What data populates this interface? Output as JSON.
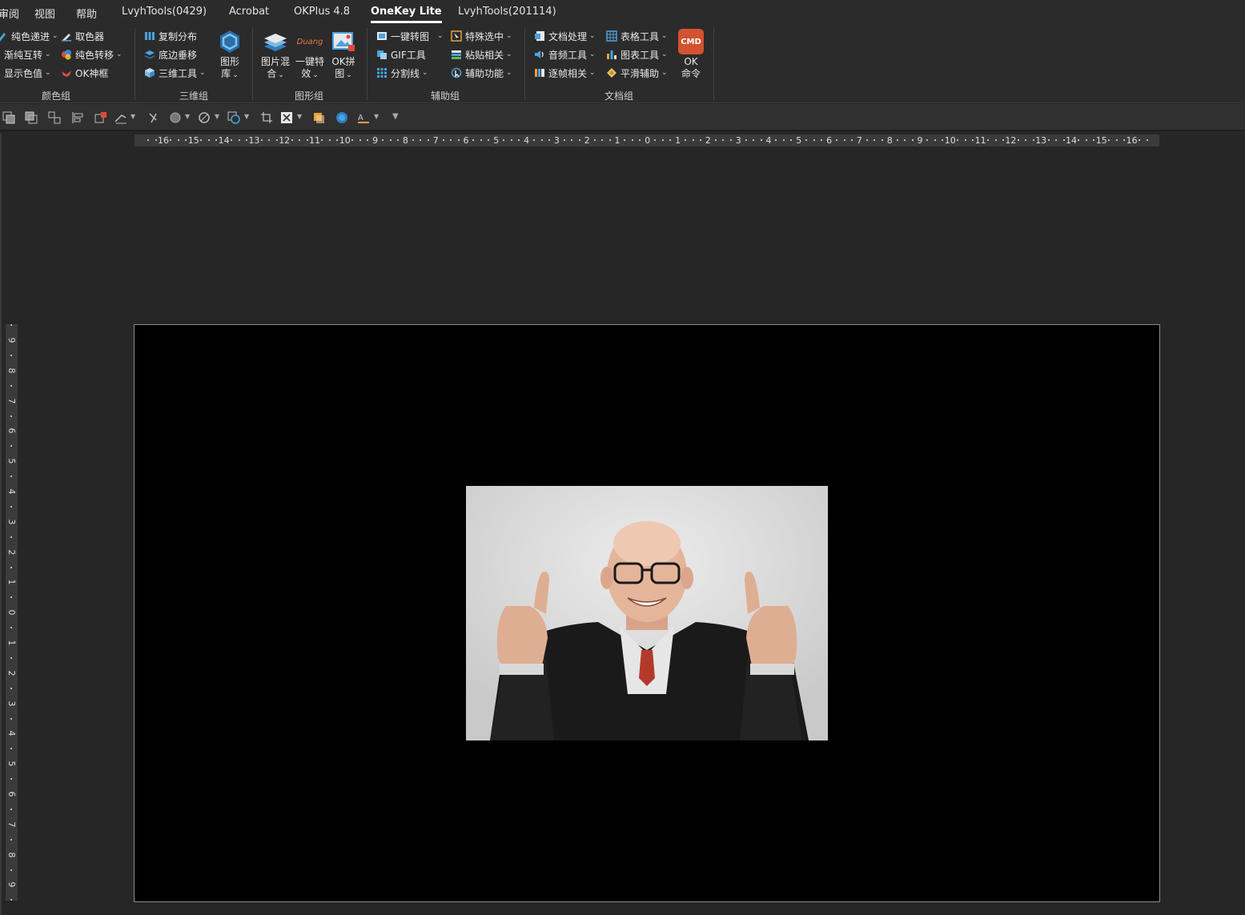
{
  "tabs": [
    "审阅",
    "视图",
    "帮助",
    "LvyhTools(0429)",
    "Acrobat",
    "OKPlus 4.8",
    "OneKey Lite",
    "LvyhTools(201114)"
  ],
  "active_tab": "OneKey Lite",
  "ribbon": {
    "color_group": {
      "label": "颜色组",
      "items": [
        "纯色递进",
        "取色器",
        "渐纯互转",
        "纯色转移",
        "显示色值",
        "OK神框"
      ]
    },
    "threed_group": {
      "label": "三维组",
      "items": [
        "复制分布",
        "底边垂移",
        "三维工具"
      ],
      "big": [
        "图形",
        "库"
      ]
    },
    "shape_group": {
      "label": "图形组",
      "big": [
        [
          "图片混",
          "合"
        ],
        [
          "一键特",
          "效"
        ],
        [
          "OK拼",
          "图"
        ]
      ],
      "duang": "Duang"
    },
    "assist_group": {
      "label": "辅助组",
      "items": [
        "一键转图",
        "特殊选中",
        "GIF工具",
        "粘贴相关",
        "分割线",
        "辅助功能"
      ]
    },
    "doc_group": {
      "label": "文档组",
      "items": [
        "文档处理",
        "表格工具",
        "音频工具",
        "图表工具",
        "逐帧相关",
        "平滑辅助"
      ],
      "cmd_badge": "CMD",
      "cmd_label": [
        "OK",
        "命令"
      ]
    }
  },
  "hruler_ticks": [
    "16",
    "15",
    "14",
    "13",
    "12",
    "11",
    "10",
    "9",
    "8",
    "7",
    "6",
    "5",
    "4",
    "3",
    "2",
    "1",
    "0",
    "1",
    "2",
    "3",
    "4",
    "5",
    "6",
    "7",
    "8",
    "9",
    "10",
    "11",
    "12",
    "13",
    "14",
    "15",
    "16"
  ],
  "vruler_ticks": [
    "9",
    "8",
    "7",
    "6",
    "5",
    "4",
    "3",
    "2",
    "1",
    "0",
    "1",
    "2",
    "3",
    "4",
    "5",
    "6",
    "7",
    "8",
    "9"
  ],
  "slide": {
    "background": "#000000",
    "image": "elderly-man-thumbs-up-photo"
  },
  "colors": {
    "cmd_badge": "#d35230",
    "accent_blue": "#4aa3df"
  }
}
